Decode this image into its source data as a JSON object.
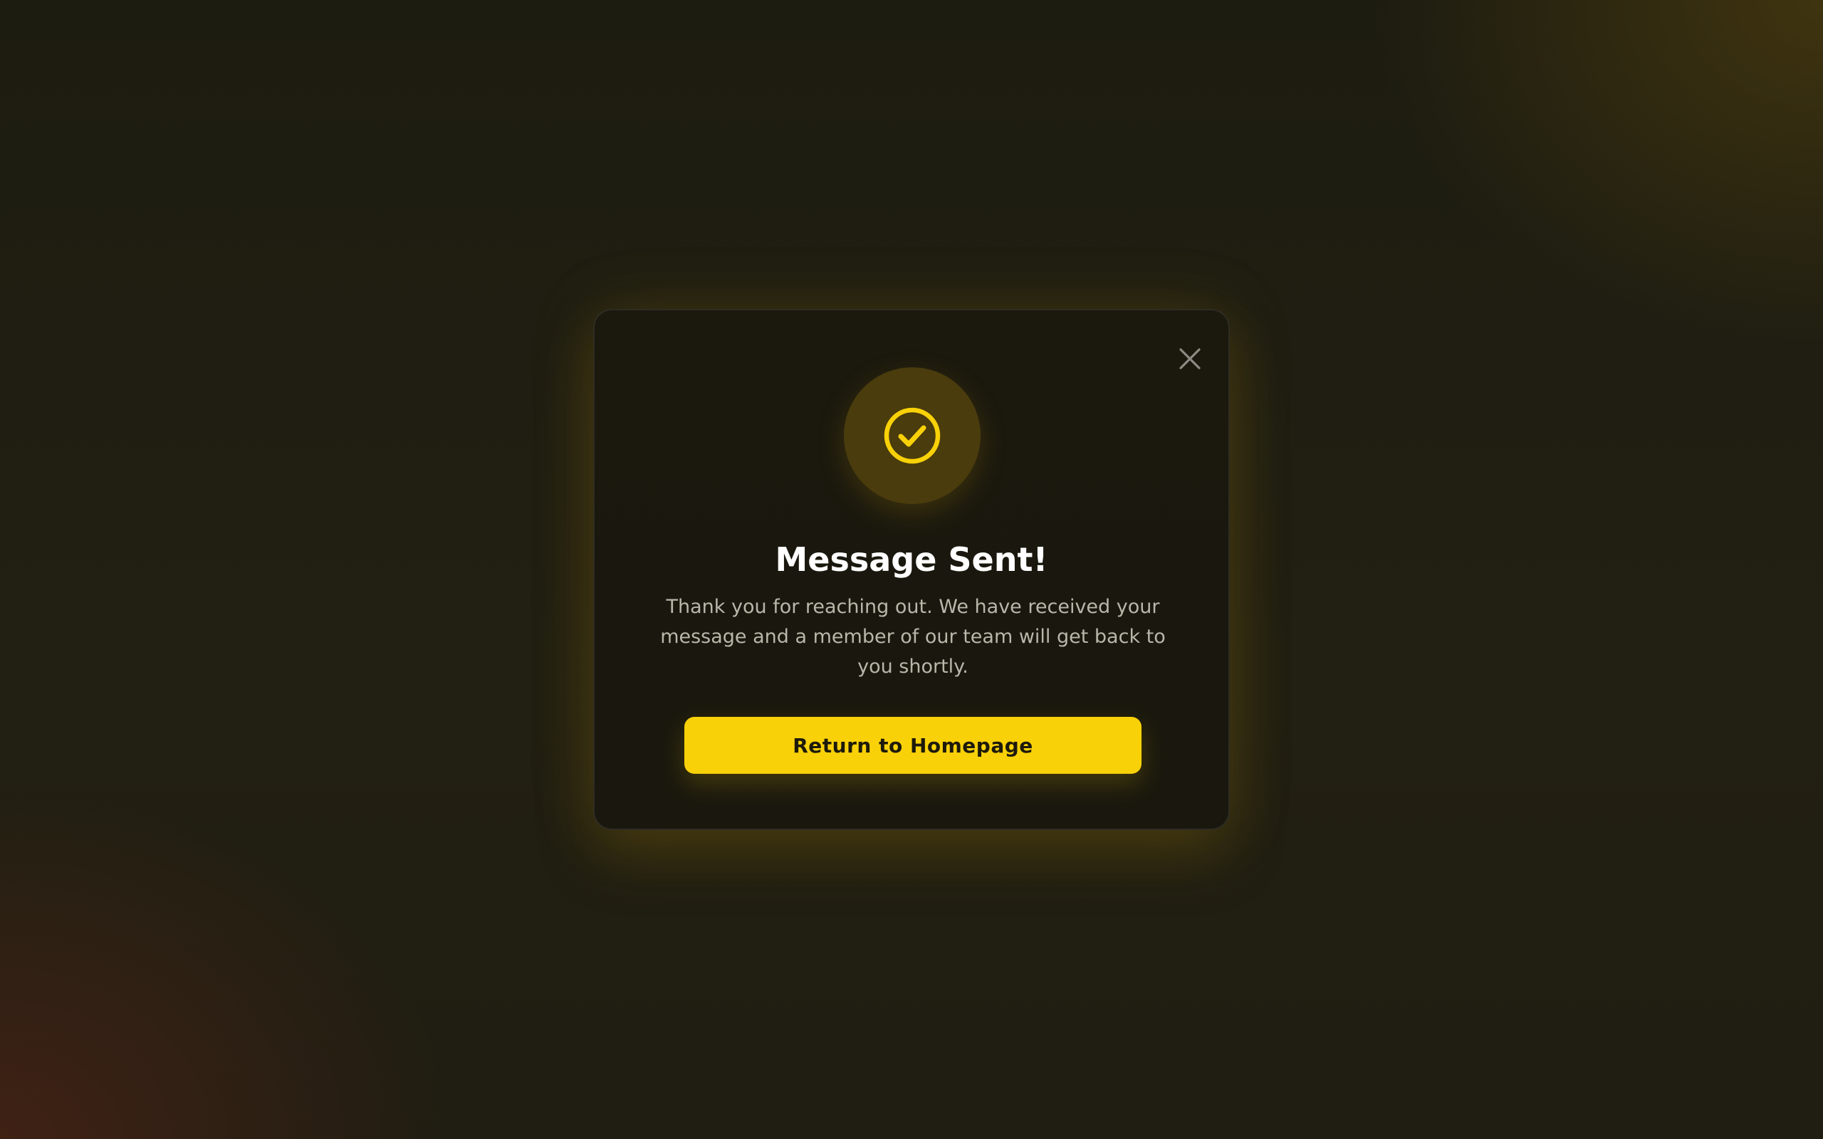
{
  "dialog": {
    "title": "Message Sent!",
    "message": "Thank you for reaching out. We have received your message and a member of our team will get back to you shortly.",
    "primary_button_label": "Return to Homepage",
    "close_icon": "close-icon",
    "status_icon": "check-circle-icon"
  },
  "colors": {
    "accent": "#f9d108",
    "icon_background": "#4a3c0d",
    "modal_background": "#1b190e",
    "page_background": "#1f1d12"
  }
}
